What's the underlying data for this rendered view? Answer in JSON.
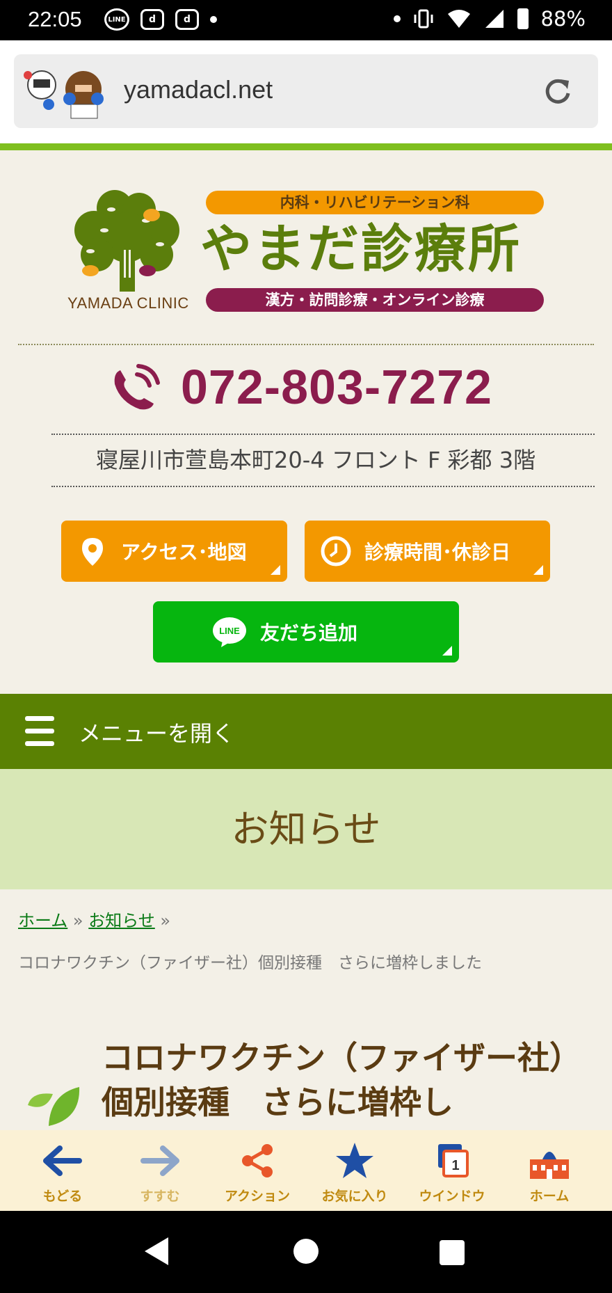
{
  "status_bar": {
    "time": "22:05",
    "notif_line": "LINE",
    "notif_d1": "d",
    "notif_d2": "d",
    "battery": "88%"
  },
  "browser": {
    "url": "yamadacl.net"
  },
  "header": {
    "logo_en": "YAMADA CLINIC",
    "top_pill": "内科・リハビリテーション科",
    "clinic_name": "やまだ診療所",
    "bottom_pill": "漢方・訪問診療・オンライン診療",
    "phone": "072-803-7272",
    "address": "寝屋川市萱島本町20-4 フロント F 彩都 3階"
  },
  "buttons": {
    "access": "アクセス･地図",
    "hours": "診療時間･休診日",
    "line_badge": "LINE",
    "line": "友だち追加"
  },
  "menu": {
    "label": "メニューを開く"
  },
  "page_title": "お知らせ",
  "breadcrumb": {
    "home": "ホーム",
    "sep": "»",
    "news": "お知らせ",
    "current": "コロナワクチン（ファイザー社）個別接種　さらに増枠しました"
  },
  "post": {
    "title": "コロナワクチン（ファイザー社）個別接種　さらに増枠し"
  },
  "toolbar": {
    "back": "もどる",
    "forward": "すすむ",
    "action": "アクション",
    "favorites": "お気に入り",
    "window": "ウインドウ",
    "window_count": "1",
    "home": "ホーム"
  },
  "colors": {
    "accent_green": "#5a8103",
    "orange": "#f39800",
    "wine": "#8b1d4d",
    "line_green": "#06b60f"
  }
}
